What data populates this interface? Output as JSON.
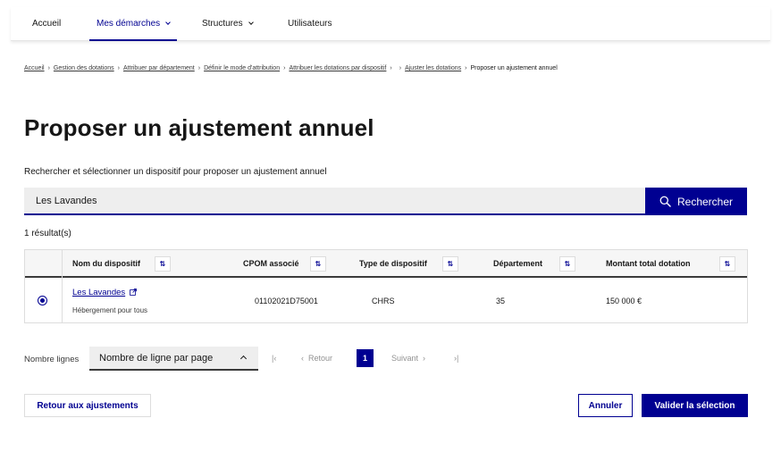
{
  "nav": {
    "items": [
      {
        "label": "Accueil",
        "dropdown": false,
        "active": false
      },
      {
        "label": "Mes démarches",
        "dropdown": true,
        "active": true
      },
      {
        "label": "Structures",
        "dropdown": true,
        "active": false
      },
      {
        "label": "Utilisateurs",
        "dropdown": false,
        "active": false
      }
    ]
  },
  "breadcrumb": {
    "items": [
      "Accueil",
      "Gestion des dotations",
      "Attribuer par département",
      "Définir le mode d'attribution",
      "Attribuer les dotations par dispositif",
      "Ajuster les dotations"
    ],
    "current": "Proposer un ajustement annuel"
  },
  "page": {
    "title": "Proposer un ajustement annuel",
    "search_label": "Rechercher et sélectionner un dispositif pour proposer un ajustement annuel"
  },
  "search": {
    "value": "Les Lavandes",
    "button_label": "Rechercher"
  },
  "results": {
    "count_text": "1 résultat(s)"
  },
  "table": {
    "headers": {
      "nom": "Nom du dispositif",
      "cpom": "CPOM associé",
      "type": "Type de dispositif",
      "departement": "Département",
      "montant": "Montant total dotation"
    },
    "sort_icon": "⇅",
    "rows": [
      {
        "selected": true,
        "nom": "Les Lavandes",
        "sub": "Hébergement pour tous",
        "cpom": "01102021D75001",
        "type": "CHRS",
        "departement": "35",
        "montant": "150 000 €"
      }
    ]
  },
  "pagination": {
    "lines_label": "Nombre lignes",
    "select_value": "Nombre de ligne par page",
    "first_icon": "first-page-icon",
    "prev_label": "Retour",
    "current_page": "1",
    "next_label": "Suivant",
    "last_icon": "last-page-icon"
  },
  "actions": {
    "back_label": "Retour aux ajustements",
    "cancel_label": "Annuler",
    "validate_label": "Valider la sélection"
  },
  "colors": {
    "primary": "#000091",
    "input_bg": "#eeeeee",
    "border": "#dddddd"
  }
}
